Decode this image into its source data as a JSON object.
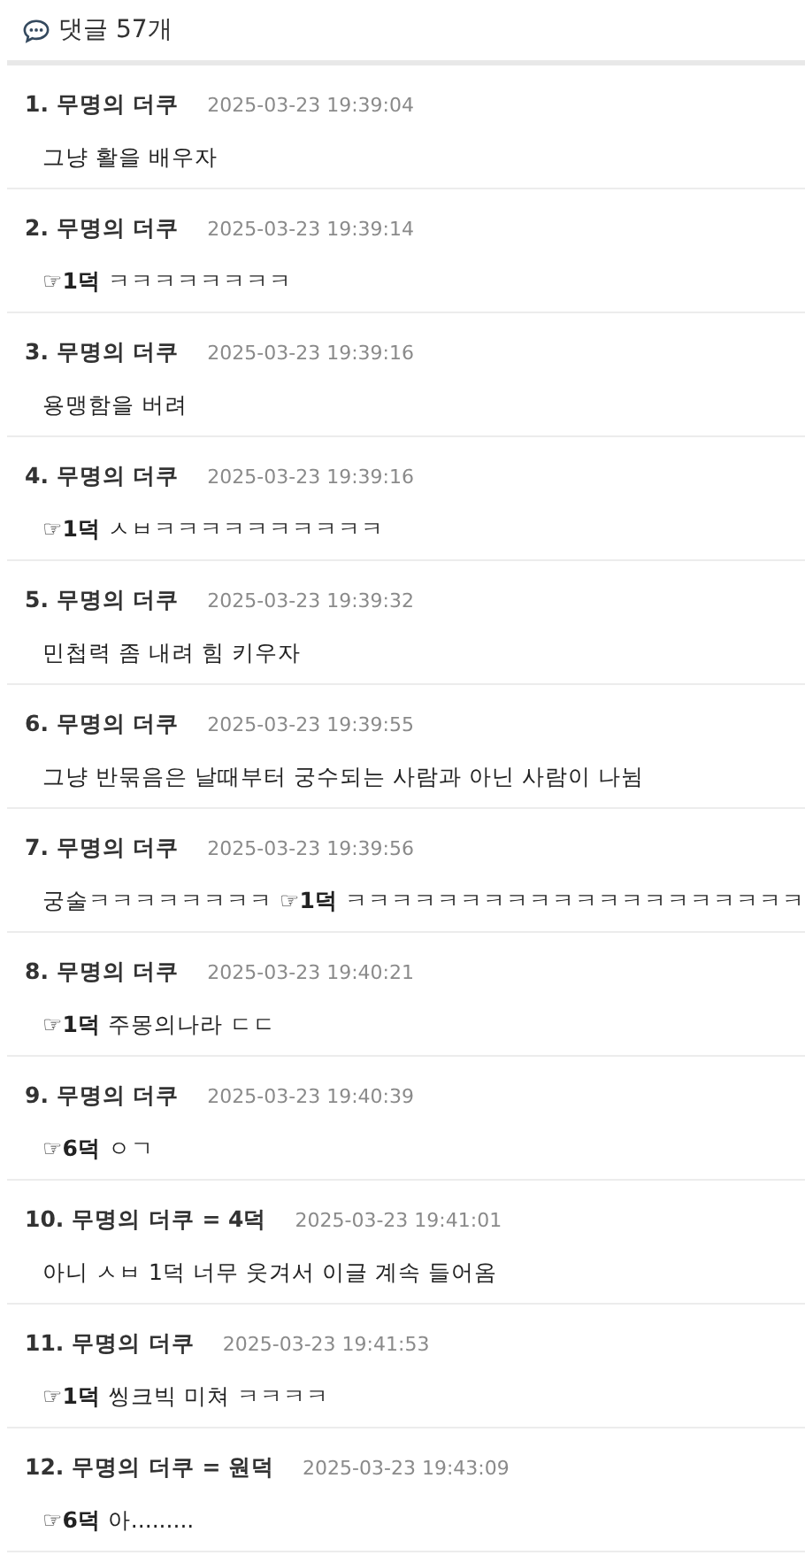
{
  "header": {
    "title": "댓글 57개"
  },
  "comments": [
    {
      "number": "1.",
      "author": "무명의 더쿠",
      "timestamp": "2025-03-23 19:39:04",
      "body": "그냥 활을 배우자"
    },
    {
      "number": "2.",
      "author": "무명의 더쿠",
      "timestamp": "2025-03-23 19:39:14",
      "body": "☞**1덕** ㅋㅋㅋㅋㅋㅋㅋㅋ"
    },
    {
      "number": "3.",
      "author": "무명의 더쿠",
      "timestamp": "2025-03-23 19:39:16",
      "body": "용맹함을 버려"
    },
    {
      "number": "4.",
      "author": "무명의 더쿠",
      "timestamp": "2025-03-23 19:39:16",
      "body": "☞**1덕** ㅅㅂㅋㅋㅋㅋㅋㅋㅋㅋㅋㅋ"
    },
    {
      "number": "5.",
      "author": "무명의 더쿠",
      "timestamp": "2025-03-23 19:39:32",
      "body": "민첩력 좀 내려 힘 키우자"
    },
    {
      "number": "6.",
      "author": "무명의 더쿠",
      "timestamp": "2025-03-23 19:39:55",
      "body": "그냥 반묶음은 날때부터 궁수되는 사람과 아닌 사람이 나뉨"
    },
    {
      "number": "7.",
      "author": "무명의 더쿠",
      "timestamp": "2025-03-23 19:39:56",
      "body": "궁술ㅋㅋㅋㅋㅋㅋㅋㅋ ☞**1덕** ㅋㅋㅋㅋㅋㅋㅋㅋㅋㅋㅋㅋㅋㅋㅋㅋㅋㅋㅋㅋ"
    },
    {
      "number": "8.",
      "author": "무명의 더쿠",
      "timestamp": "2025-03-23 19:40:21",
      "body": "☞**1덕** 주몽의나라 ㄷㄷ"
    },
    {
      "number": "9.",
      "author": "무명의 더쿠",
      "timestamp": "2025-03-23 19:40:39",
      "body": "☞**6덕** ㅇㄱ"
    },
    {
      "number": "10.",
      "author": "무명의 더쿠 = 4덕",
      "timestamp": "2025-03-23 19:41:01",
      "body": "아니 ㅅㅂ 1덕 너무 웃겨서 이글 계속 들어옴"
    },
    {
      "number": "11.",
      "author": "무명의 더쿠",
      "timestamp": "2025-03-23 19:41:53",
      "body": "☞**1덕** 씽크빅 미쳐 ㅋㅋㅋㅋ"
    },
    {
      "number": "12.",
      "author": "무명의 더쿠 = 원덕",
      "timestamp": "2025-03-23 19:43:09",
      "body": "☞**6덕** 아........."
    }
  ]
}
